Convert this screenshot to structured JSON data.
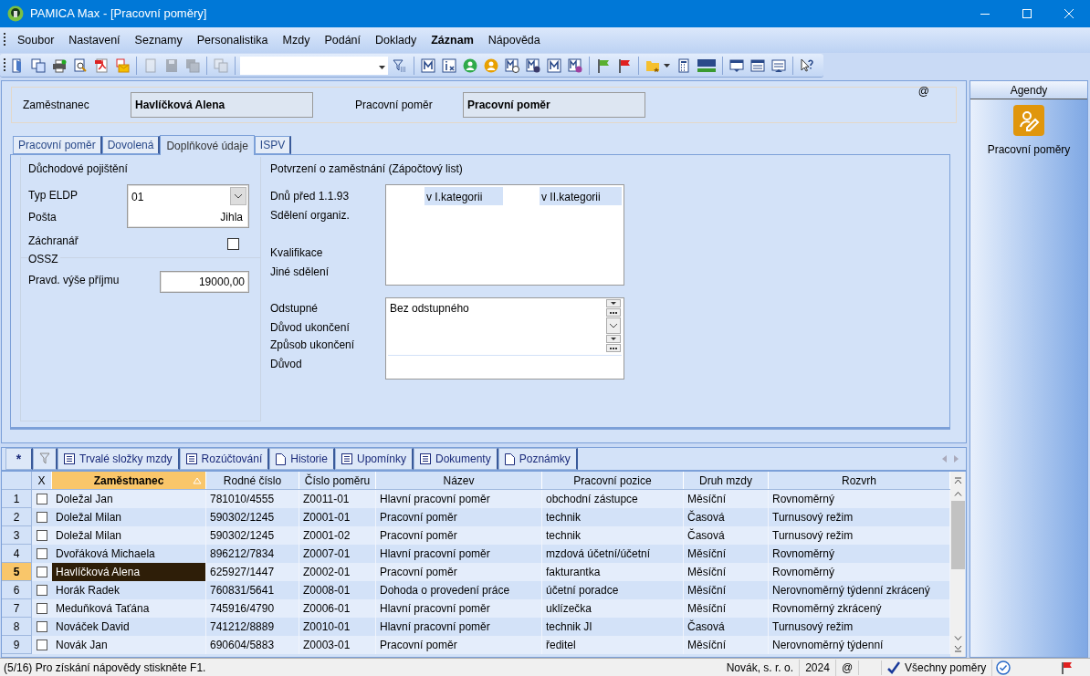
{
  "window": {
    "title": "PAMICA Max - [Pracovní poměry]"
  },
  "menu": [
    {
      "label": "Soubor",
      "bold": false
    },
    {
      "label": "Nastavení",
      "bold": false
    },
    {
      "label": "Seznamy",
      "bold": false
    },
    {
      "label": "Personalistika",
      "bold": false
    },
    {
      "label": "Mzdy",
      "bold": false
    },
    {
      "label": "Podání",
      "bold": false
    },
    {
      "label": "Doklady",
      "bold": false
    },
    {
      "label": "Záznam",
      "bold": true
    },
    {
      "label": "Nápověda",
      "bold": false
    }
  ],
  "header": {
    "at": "@",
    "employee_label": "Zaměstnanec",
    "employee": "Havlíčková Alena",
    "relation_label": "Pracovní poměr",
    "relation": "Pracovní poměr"
  },
  "tabs": [
    {
      "label": "Pracovní poměr",
      "selected": false
    },
    {
      "label": "Dovolená",
      "selected": false
    },
    {
      "label": "Doplňkové údaje",
      "selected": true
    },
    {
      "label": "ISPV",
      "selected": false
    }
  ],
  "pension": {
    "title": "Důchodové pojištění",
    "eldp_label": "Typ ELDP",
    "eldp": "01",
    "post_label": "Pošta",
    "post": "Jihla",
    "rescuer_label": "Záchranář",
    "rescuer": false,
    "ossz_title": "OSSZ",
    "income_label": "Pravd. výše příjmu",
    "income": "19000,00"
  },
  "confirmation": {
    "title": "Potvrzení o zaměstnání (Zápočtový list)",
    "days_label": "Dnů před 1.1.93",
    "cat1": "v I.kategorii",
    "cat2": "v II.kategorii",
    "org_label": "Sdělení organiz.",
    "qual_label": "Kvalifikace",
    "other_label": "Jiné sdělení",
    "severance_label": "Odstupné",
    "severance": "Bez odstupného",
    "end_reason_label": "Důvod ukončení",
    "end_way_label": "Způsob ukončení",
    "reason_label": "Důvod"
  },
  "agenda": {
    "title": "Agendy",
    "item": "Pracovní poměry"
  },
  "bottom_tabs": [
    {
      "label": "*",
      "kind": "star"
    },
    {
      "kind": "filter"
    },
    {
      "label": "Trvalé složky mzdy",
      "kind": "list"
    },
    {
      "label": "Rozúčtování",
      "kind": "list"
    },
    {
      "label": "Historie",
      "kind": "page"
    },
    {
      "label": "Upomínky",
      "kind": "list"
    },
    {
      "label": "Dokumenty",
      "kind": "list"
    },
    {
      "label": "Poznámky",
      "kind": "page"
    }
  ],
  "table": {
    "columns": [
      "X",
      "Zaměstnanec",
      "Rodné číslo",
      "Číslo poměru",
      "Název",
      "Pracovní pozice",
      "Druh mzdy",
      "Rozvrh"
    ],
    "rows": [
      {
        "index": "1",
        "checked": false,
        "selected": false,
        "cells": [
          "",
          "Doležal Jan",
          "781010/4555",
          "Z0011-01",
          "Hlavní pracovní poměr",
          "obchodní zástupce",
          "Měsíční",
          "Rovnoměrný"
        ]
      },
      {
        "index": "2",
        "checked": false,
        "selected": false,
        "cells": [
          "",
          "Doležal Milan",
          "590302/1245",
          "Z0001-01",
          "Pracovní poměr",
          "technik",
          "Časová",
          "Turnusový režim"
        ]
      },
      {
        "index": "3",
        "checked": false,
        "selected": false,
        "cells": [
          "",
          "Doležal Milan",
          "590302/1245",
          "Z0001-02",
          "Pracovní poměr",
          "technik",
          "Časová",
          "Turnusový režim"
        ]
      },
      {
        "index": "4",
        "checked": false,
        "selected": false,
        "cells": [
          "",
          "Dvořáková Michaela",
          "896212/7834",
          "Z0007-01",
          "Hlavní pracovní poměr",
          "mzdová účetní/účetní",
          "Měsíční",
          "Rovnoměrný"
        ]
      },
      {
        "index": "5",
        "checked": false,
        "selected": true,
        "cells": [
          "",
          "Havlíčková Alena",
          "625927/1447",
          "Z0002-01",
          "Pracovní poměr",
          "fakturantka",
          "Měsíční",
          "Rovnoměrný"
        ]
      },
      {
        "index": "6",
        "checked": false,
        "selected": false,
        "cells": [
          "",
          "Horák Radek",
          "760831/5641",
          "Z0008-01",
          "Dohoda o provedení práce",
          "účetní poradce",
          "Měsíční",
          "Nerovnoměrný týdenní zkrácený"
        ]
      },
      {
        "index": "7",
        "checked": false,
        "selected": false,
        "cells": [
          "",
          "Meduňková Taťána",
          "745916/4790",
          "Z0006-01",
          "Hlavní pracovní poměr",
          "uklízečka",
          "Měsíční",
          "Rovnoměrný zkrácený"
        ]
      },
      {
        "index": "8",
        "checked": false,
        "selected": false,
        "cells": [
          "",
          "Nováček David",
          "741212/8889",
          "Z0010-01",
          "Hlavní pracovní poměr",
          "technik JI",
          "Časová",
          "Turnusový režim"
        ]
      },
      {
        "index": "9",
        "checked": false,
        "selected": false,
        "cells": [
          "",
          "Novák Jan",
          "690604/5883",
          "Z0003-01",
          "Pracovní poměr",
          "ředitel",
          "Měsíční",
          "Nerovnoměrný týdenní"
        ]
      }
    ]
  },
  "status_bar": {
    "help": "(5/16) Pro získání nápovědy stiskněte F1.",
    "company": "Novák, s. r. o.",
    "year": "2024",
    "at": "@",
    "filter": "Všechny poměry"
  }
}
